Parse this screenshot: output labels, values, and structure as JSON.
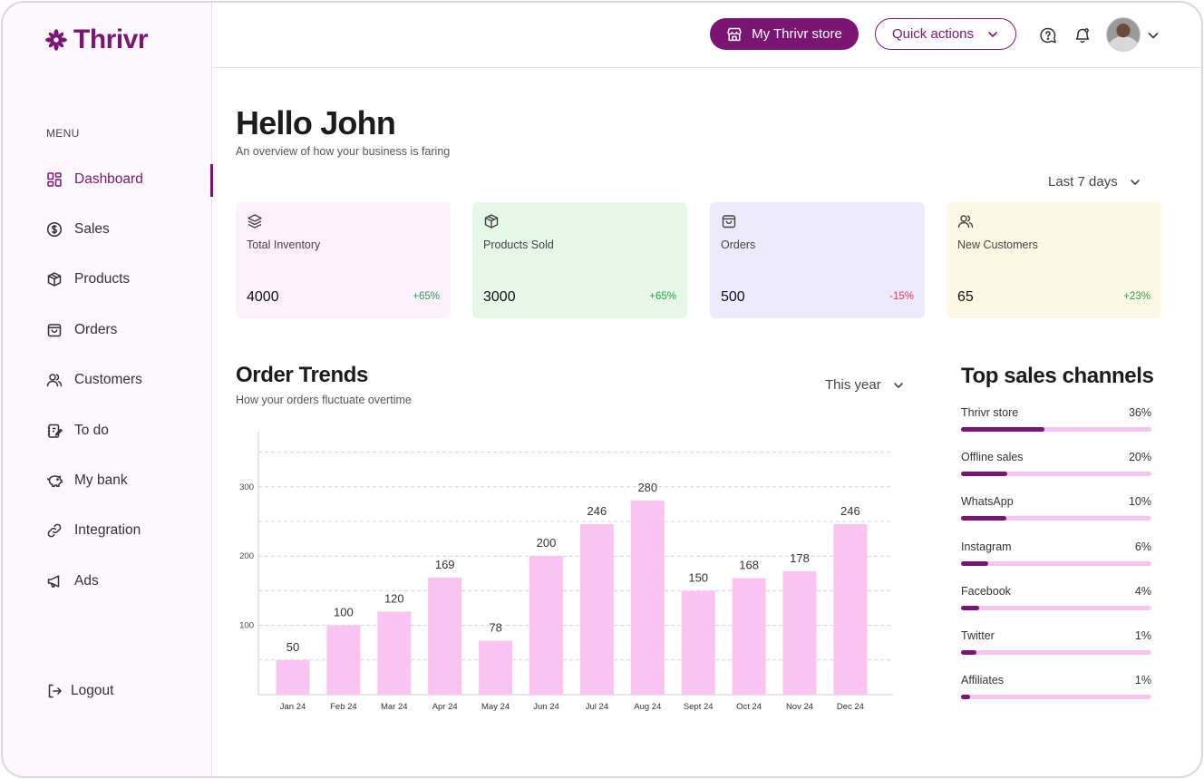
{
  "brand": {
    "name": "Thrivr",
    "color": "#7b1574"
  },
  "sidebar": {
    "menu_label": "MENU",
    "items": [
      {
        "label": "Dashboard",
        "icon": "dashboard-icon",
        "active": true
      },
      {
        "label": "Sales",
        "icon": "dollar-icon"
      },
      {
        "label": "Products",
        "icon": "box-icon"
      },
      {
        "label": "Orders",
        "icon": "shopping-bag-icon"
      },
      {
        "label": "Customers",
        "icon": "users-icon"
      },
      {
        "label": "To do",
        "icon": "notepad-icon"
      },
      {
        "label": "My bank",
        "icon": "piggy-bank-icon"
      },
      {
        "label": "Integration",
        "icon": "link-icon"
      },
      {
        "label": "Ads",
        "icon": "megaphone-icon"
      }
    ],
    "logout_label": "Logout"
  },
  "header": {
    "store_button": "My Thrivr store",
    "quick_actions": "Quick actions"
  },
  "main": {
    "greeting": "Hello John",
    "subtitle": "An overview of how your business is faring",
    "period": "Last 7 days",
    "cards": [
      {
        "label": "Total Inventory",
        "value": "4000",
        "change": "+65%",
        "bg": "#fcf1fc",
        "icon": "stack-icon"
      },
      {
        "label": "Products Sold",
        "value": "3000",
        "change": "+65%",
        "bg": "#e6f6e7",
        "icon": "box-icon"
      },
      {
        "label": "Orders",
        "value": "500",
        "change": "-15%",
        "bg": "#eceafc",
        "icon": "shopping-bag-icon"
      },
      {
        "label": "New Customers",
        "value": "65",
        "change": "+23%",
        "bg": "#fdf8e6",
        "icon": "users-icon"
      }
    ]
  },
  "trends": {
    "title": "Order Trends",
    "subtitle": "How your orders fluctuate overtime",
    "period": "This year"
  },
  "chart_data": {
    "type": "bar",
    "categories": [
      "Jan 24",
      "Feb 24",
      "Mar 24",
      "Apr 24",
      "May 24",
      "Jun 24",
      "Jul 24",
      "Aug 24",
      "Sept 24",
      "Oct 24",
      "Nov 24",
      "Dec 24"
    ],
    "values": [
      50,
      100,
      120,
      169,
      78,
      200,
      246,
      280,
      150,
      168,
      178,
      246
    ],
    "yticks": [
      100,
      200,
      300
    ],
    "ylim": [
      0,
      350
    ],
    "grid": true,
    "bar_color": "#f9c4f2"
  },
  "channels": {
    "title": "Top sales channels",
    "items": [
      {
        "name": "Thrivr store",
        "pct": "36%",
        "value": 36
      },
      {
        "name": "Offline sales",
        "pct": "20%",
        "value": 20
      },
      {
        "name": "WhatsApp",
        "pct": "10%",
        "value": 10
      },
      {
        "name": "Instagram",
        "pct": "6%",
        "value": 6
      },
      {
        "name": "Facebook",
        "pct": "4%",
        "value": 4
      },
      {
        "name": "Twitter",
        "pct": "1%",
        "value": 1
      },
      {
        "name": "Affiliates",
        "pct": "1%",
        "value": 1
      }
    ]
  }
}
